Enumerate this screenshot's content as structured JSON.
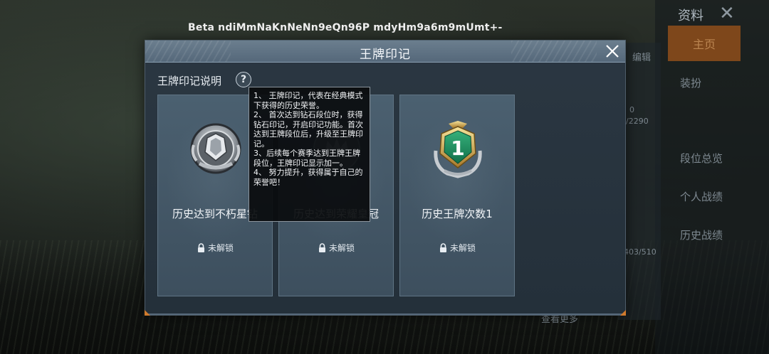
{
  "watermark": {
    "text": "Beta ndiMmNaKnNeNn9eQn96P mdyHm9a6m9mUmt+-"
  },
  "background": {
    "right_title": "资料",
    "home_button": "主页",
    "menu": [
      "装扮",
      "段位总览",
      "个人战绩",
      "历史战绩"
    ],
    "side_texts": [
      "编辑",
      "0",
      "0/2290",
      "403/510",
      "查看更多"
    ]
  },
  "dialog": {
    "title": "王牌印记",
    "section_title": "王牌印记说明",
    "help_label": "?",
    "cards": [
      {
        "title": "历史达到不朽星钻",
        "lock_text": "未解锁",
        "emblem": "immortal-diamond-emblem-icon"
      },
      {
        "title": "历史达到荣耀皇冠",
        "lock_text": "未解锁",
        "emblem": "glory-crown-emblem-icon"
      },
      {
        "title": "历史王牌次数1",
        "lock_text": "未解锁",
        "emblem": "ace-count-emblem-icon"
      }
    ],
    "tooltip": {
      "lines": [
        "1、 王牌印记，代表在经典模式下获得的历史荣誉。",
        "2、 首次达到钻石段位时，获得钻石印记，开启印记功能。首次达到王牌段位后，升级至王牌印记。",
        "3、后续每个赛季达到王牌王牌段位，王牌印记显示加一。",
        "4、 努力提升，获得属于自己的荣誉吧！"
      ]
    }
  },
  "colors": {
    "dialog_bg": "#24303a",
    "header": "#5f7284",
    "accent": "#d07a2c",
    "card": "#45596a"
  }
}
